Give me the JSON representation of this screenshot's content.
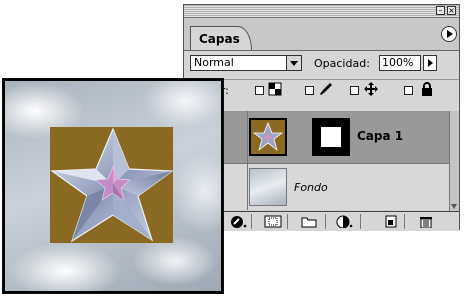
{
  "panel": {
    "tab_label": "Capas",
    "blend_mode": "Normal",
    "opacity_label": "Opacidad:",
    "opacity_value": "100%",
    "lock_label": "ar:",
    "layers": [
      {
        "name": "Capa 1"
      },
      {
        "name": "Fondo"
      }
    ],
    "window_buttons": {
      "minimize": "–",
      "close": "×"
    }
  },
  "colors": {
    "panel_bg": "#d6d6d6",
    "selected_layer": "#999999",
    "star_background": "#8a6a22"
  },
  "icons": [
    "minimize-icon",
    "close-icon",
    "panel-menu-icon",
    "transparency-lock-icon",
    "brush-lock-icon",
    "move-lock-icon",
    "padlock-icon",
    "layer-style-icon",
    "mask-icon",
    "new-set-icon",
    "adjustment-layer-icon",
    "new-layer-icon",
    "trash-icon"
  ]
}
